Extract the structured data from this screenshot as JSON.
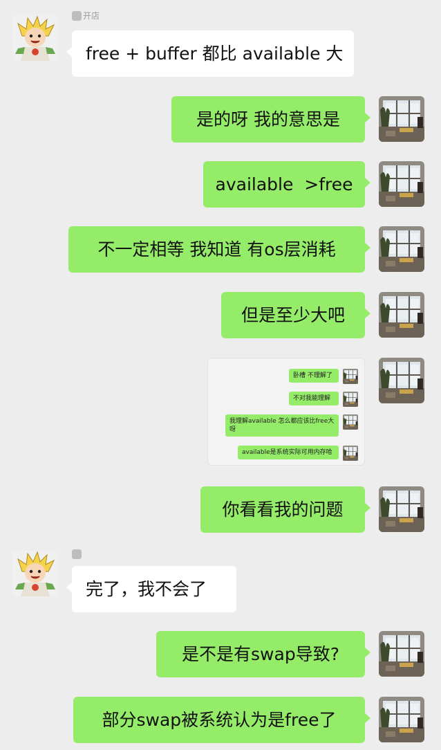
{
  "chat": {
    "sender_left_name": "开店",
    "messages": [
      {
        "from": "left",
        "text": "free + buffer 都比 available 大"
      },
      {
        "from": "right",
        "text": "是的呀 我的意思是"
      },
      {
        "from": "right",
        "text": "available  >free"
      },
      {
        "from": "right",
        "text": "不一定相等 我知道 有os层消耗"
      },
      {
        "from": "right",
        "text": "但是至少大吧"
      },
      {
        "from": "right",
        "type": "image"
      },
      {
        "from": "right",
        "text": "你看看我的问题"
      },
      {
        "from": "left",
        "text": "完了，我不会了"
      },
      {
        "from": "right",
        "text": "是不是有swap导致?"
      },
      {
        "from": "right",
        "text": "部分swap被系统认为是free了"
      }
    ],
    "embedded_screenshot": {
      "messages": [
        "卧槽 不理解了",
        "不对我能理解",
        "我理解available 怎么都应该比free大呀",
        "available是系统实际可用内存哈"
      ]
    }
  },
  "colors": {
    "background": "#ededed",
    "self_bubble": "#95ec69",
    "other_bubble": "#ffffff"
  },
  "icons": {
    "left_avatar": "anime-character-avatar",
    "right_avatar": "room-window-photo-avatar"
  }
}
